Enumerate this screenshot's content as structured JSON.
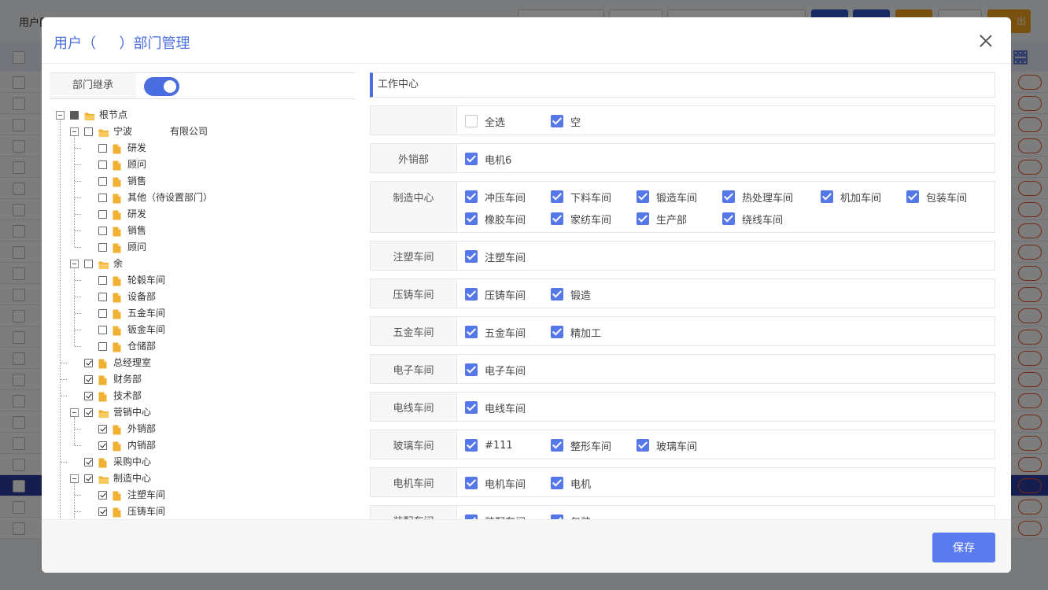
{
  "background": {
    "page_title": "用户配…",
    "export_btn": "出"
  },
  "modal": {
    "title": "用户（ 　 ）部门管理",
    "save_label": "保存"
  },
  "left": {
    "inherit_label": "部门继承",
    "inherit_on": true,
    "tree": [
      {
        "level": 0,
        "label": "根节点",
        "type": "folder",
        "check": "partial",
        "expander": true
      },
      {
        "level": 1,
        "label": "宁波　　　　有限公司",
        "type": "folder",
        "check": "off",
        "expander": true
      },
      {
        "level": 2,
        "label": "研发",
        "type": "file",
        "check": "off"
      },
      {
        "level": 2,
        "label": "顾问",
        "type": "file",
        "check": "off"
      },
      {
        "level": 2,
        "label": "销售",
        "type": "file",
        "check": "off"
      },
      {
        "level": 2,
        "label": "其他（待设置部门）",
        "type": "file",
        "check": "off"
      },
      {
        "level": 2,
        "label": "研发",
        "type": "file",
        "check": "off"
      },
      {
        "level": 2,
        "label": "销售",
        "type": "file",
        "check": "off"
      },
      {
        "level": 2,
        "label": "顾问",
        "type": "file",
        "check": "off"
      },
      {
        "level": 1,
        "label": "余　　",
        "type": "folder",
        "check": "off",
        "expander": true
      },
      {
        "level": 2,
        "label": "轮毂车间",
        "type": "file",
        "check": "off"
      },
      {
        "level": 2,
        "label": "设备部",
        "type": "file",
        "check": "off"
      },
      {
        "level": 2,
        "label": "五金车间",
        "type": "file",
        "check": "off"
      },
      {
        "level": 2,
        "label": "钣金车间",
        "type": "file",
        "check": "off"
      },
      {
        "level": 2,
        "label": "仓储部",
        "type": "file",
        "check": "off"
      },
      {
        "level": 1,
        "label": "总经理室",
        "type": "file",
        "check": "on"
      },
      {
        "level": 1,
        "label": "财务部",
        "type": "file",
        "check": "on"
      },
      {
        "level": 1,
        "label": "技术部",
        "type": "file",
        "check": "on"
      },
      {
        "level": 1,
        "label": "营销中心",
        "type": "folder",
        "check": "on",
        "expander": true
      },
      {
        "level": 2,
        "label": "外销部",
        "type": "file",
        "check": "on"
      },
      {
        "level": 2,
        "label": "内销部",
        "type": "file",
        "check": "on"
      },
      {
        "level": 1,
        "label": "采购中心",
        "type": "file",
        "check": "on"
      },
      {
        "level": 1,
        "label": "制造中心",
        "type": "folder",
        "check": "on",
        "expander": true
      },
      {
        "level": 2,
        "label": "注塑车间",
        "type": "file",
        "check": "on"
      },
      {
        "level": 2,
        "label": "压铸车间",
        "type": "file",
        "check": "on"
      }
    ]
  },
  "right": {
    "section_title": "工作中心",
    "groups": [
      {
        "label": "",
        "items": [
          {
            "label": "全选",
            "checked": false
          },
          {
            "label": "空",
            "checked": true
          }
        ]
      },
      {
        "label": "外销部",
        "items": [
          {
            "label": "电机6",
            "checked": true
          }
        ]
      },
      {
        "label": "制造中心",
        "items": [
          {
            "label": "冲压车间",
            "checked": true
          },
          {
            "label": "下料车间",
            "checked": true
          },
          {
            "label": "锻造车间",
            "checked": true
          },
          {
            "label": "热处理车间",
            "checked": true
          },
          {
            "label": "机加车间",
            "checked": true
          },
          {
            "label": "包装车间",
            "checked": true
          },
          {
            "label": "橡胶车间",
            "checked": true
          },
          {
            "label": "家纺车间",
            "checked": true
          },
          {
            "label": "生产部",
            "checked": true
          },
          {
            "label": "绕线车间",
            "checked": true
          }
        ]
      },
      {
        "label": "注塑车间",
        "items": [
          {
            "label": "注塑车间",
            "checked": true
          }
        ]
      },
      {
        "label": "压铸车间",
        "items": [
          {
            "label": "压铸车间",
            "checked": true
          },
          {
            "label": "锻造",
            "checked": true
          }
        ]
      },
      {
        "label": "五金车间",
        "items": [
          {
            "label": "五金车间",
            "checked": true
          },
          {
            "label": "精加工",
            "checked": true
          }
        ]
      },
      {
        "label": "电子车间",
        "items": [
          {
            "label": "电子车间",
            "checked": true
          }
        ]
      },
      {
        "label": "电线车间",
        "items": [
          {
            "label": "电线车间",
            "checked": true
          }
        ]
      },
      {
        "label": "玻璃车间",
        "items": [
          {
            "label": "#111",
            "checked": true
          },
          {
            "label": "整形车间",
            "checked": true
          },
          {
            "label": "玻璃车间",
            "checked": true
          }
        ]
      },
      {
        "label": "电机车间",
        "items": [
          {
            "label": "电机车间",
            "checked": true
          },
          {
            "label": "电机",
            "checked": true
          }
        ]
      },
      {
        "label": "装配车间",
        "items": [
          {
            "label": "装配车间",
            "checked": true
          },
          {
            "label": "包装",
            "checked": true
          }
        ]
      }
    ]
  },
  "colors": {
    "accent": "#4a6ee0",
    "checkbox": "#5577e8",
    "folder": "#f0b132"
  }
}
